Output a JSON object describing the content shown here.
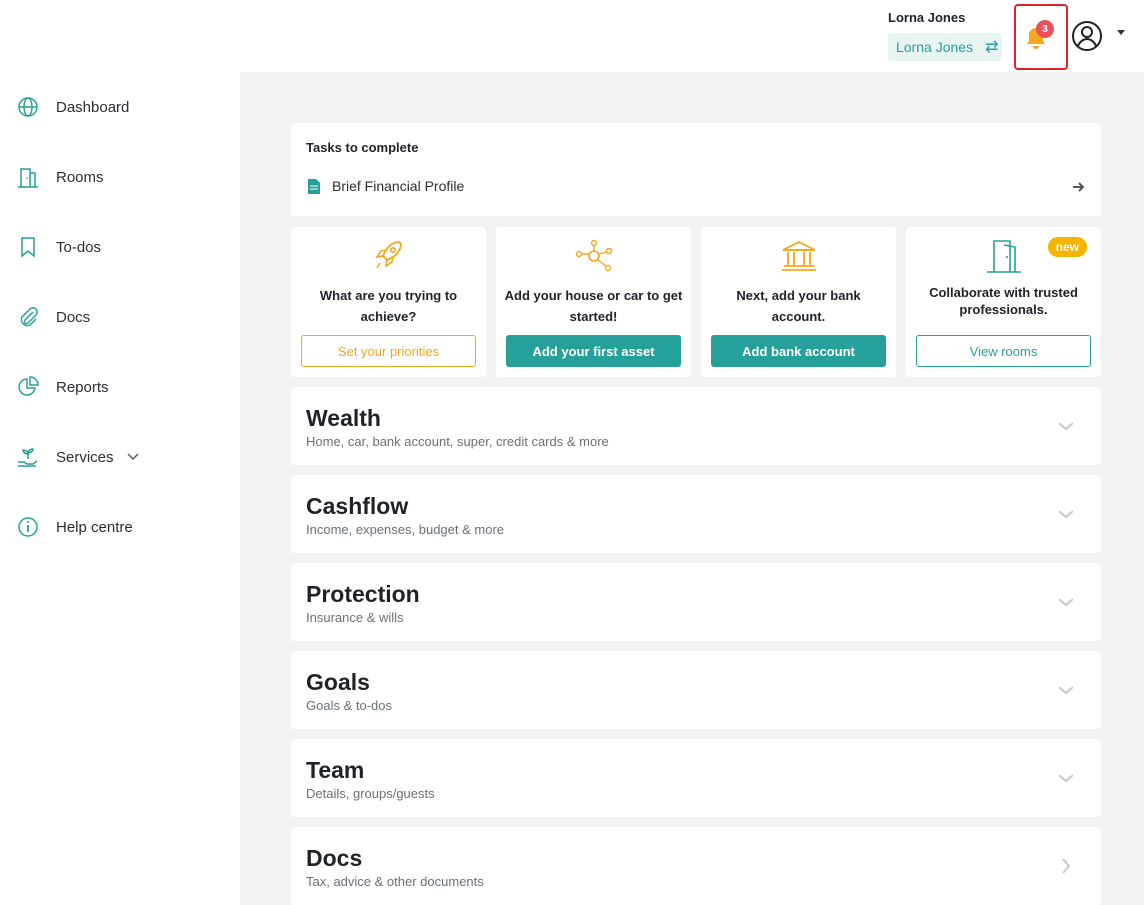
{
  "header": {
    "user_name": "Lorna Jones",
    "switch_label": "Lorna Jones",
    "switch_icon": "⇄",
    "notification_count": "3"
  },
  "sidebar": {
    "items": [
      {
        "label": "Dashboard",
        "icon": "globe-icon"
      },
      {
        "label": "Rooms",
        "icon": "building-icon"
      },
      {
        "label": "To-dos",
        "icon": "bookmark-icon"
      },
      {
        "label": "Docs",
        "icon": "paperclip-icon"
      },
      {
        "label": "Reports",
        "icon": "pie-chart-icon"
      },
      {
        "label": "Services",
        "icon": "plant-hand-icon"
      },
      {
        "label": "Help centre",
        "icon": "info-icon"
      }
    ]
  },
  "tasks": {
    "title": "Tasks to complete",
    "items": [
      {
        "label": "Brief Financial Profile"
      }
    ]
  },
  "onboarding": [
    {
      "text": "What are you trying to achieve?",
      "button": "Set your priorities",
      "icon": "rocket-icon"
    },
    {
      "text": "Add your house or car to get started!",
      "button": "Add your first asset",
      "icon": "network-icon"
    },
    {
      "text": "Next, add your bank account.",
      "button": "Add bank account",
      "icon": "bank-icon"
    },
    {
      "text": "Collaborate with trusted professionals.",
      "button": "View rooms",
      "badge": "new",
      "icon": "door-icon"
    }
  ],
  "sections": [
    {
      "title": "Wealth",
      "subtitle": "Home, car, bank account, super, credit cards & more"
    },
    {
      "title": "Cashflow",
      "subtitle": "Income, expenses, budget & more"
    },
    {
      "title": "Protection",
      "subtitle": "Insurance & wills"
    },
    {
      "title": "Goals",
      "subtitle": "Goals & to-dos"
    },
    {
      "title": "Team",
      "subtitle": "Details, groups/guests"
    },
    {
      "title": "Docs",
      "subtitle": "Tax, advice & other documents"
    }
  ],
  "colors": {
    "teal": "#26a09a",
    "orange": "#f3a81b",
    "badge_red": "#e8505b",
    "highlight_red": "#e2222b"
  }
}
